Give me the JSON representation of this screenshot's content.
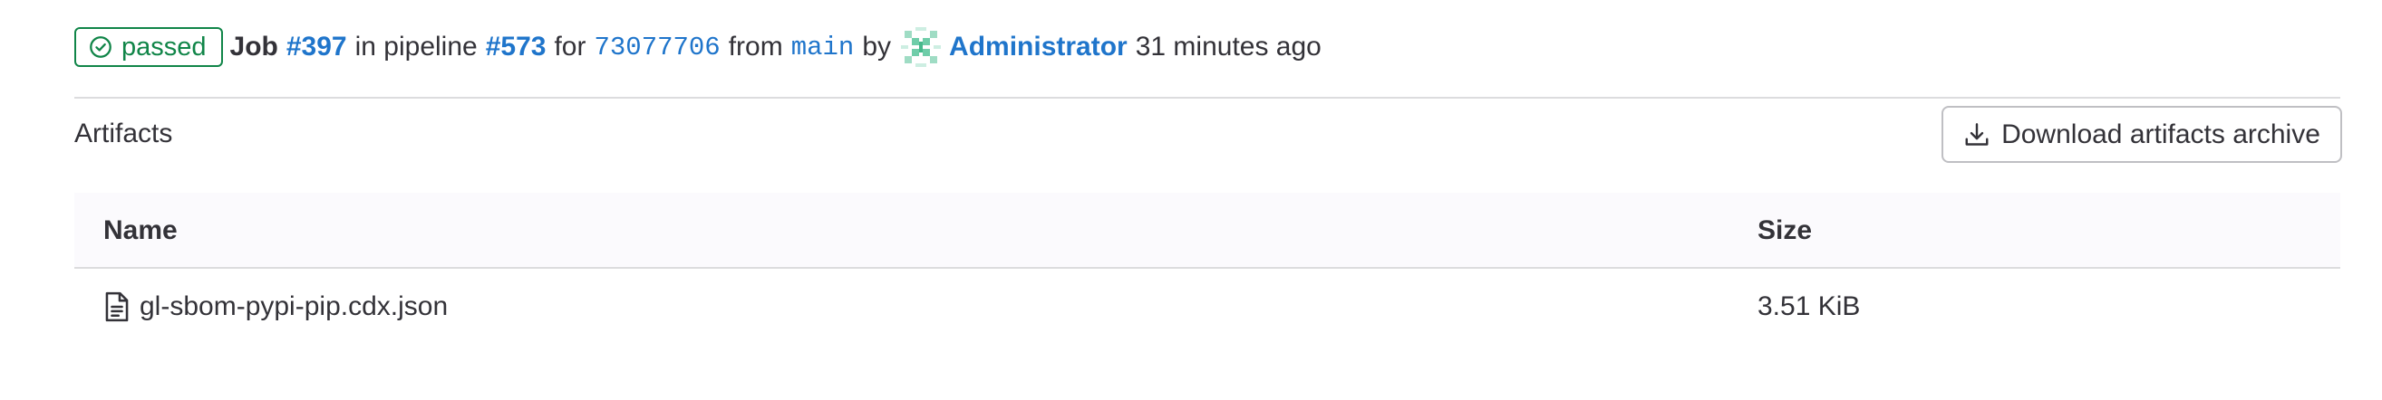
{
  "job_header": {
    "status": "passed",
    "job_label": "Job",
    "job_id": "#397",
    "in_pipeline_text": "in pipeline",
    "pipeline_id": "#573",
    "for_text": "for",
    "commit_sha": "73077706",
    "from_text": "from",
    "branch": "main",
    "by_text": "by",
    "user": "Administrator",
    "time_ago": "31 minutes ago",
    "status_color": "#108548",
    "link_color": "#1f75cb"
  },
  "artifacts": {
    "title": "Artifacts",
    "download_button_label": "Download artifacts archive",
    "columns": {
      "name": "Name",
      "size": "Size"
    },
    "files": [
      {
        "icon": "file-text-icon",
        "name": "gl-sbom-pypi-pip.cdx.json",
        "size": "3.51 KiB"
      }
    ]
  }
}
